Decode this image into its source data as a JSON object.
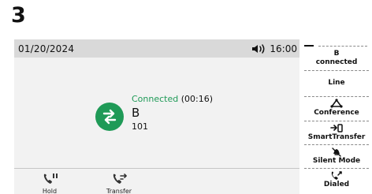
{
  "page": {
    "step_number": "3"
  },
  "status_bar": {
    "date": "01/20/2024",
    "time": "16:00",
    "icons": [
      "speaker-volume-icon"
    ]
  },
  "call": {
    "status": "Connected",
    "duration": "(00:16)",
    "name": "B",
    "number": "101",
    "avatar_icon": "transfer-arrows-icon"
  },
  "softkeys": [
    {
      "label": "Hold",
      "icon": "hold-phone-icon"
    },
    {
      "label": "Transfer",
      "icon": "transfer-phone-icon"
    }
  ],
  "side_panel": {
    "contact": {
      "name": "B",
      "status": "connected"
    },
    "items": [
      {
        "label": "Line",
        "icon": ""
      },
      {
        "label": "Conference",
        "icon": "conference-icon"
      },
      {
        "label": "SmartTransfer",
        "icon": "smart-transfer-icon"
      },
      {
        "label": "Silent Mode",
        "icon": "silent-mode-icon"
      },
      {
        "label": "Dialed",
        "icon": "dialed-call-icon"
      }
    ]
  },
  "colors": {
    "connected": "#1f9a57",
    "status_bar": "#d9d9d9",
    "screen": "#f2f2f2",
    "text": "#111111"
  }
}
